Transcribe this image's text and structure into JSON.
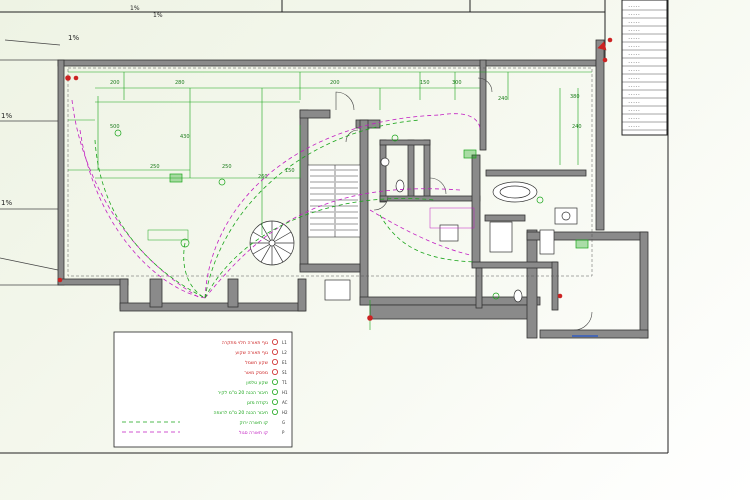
{
  "sheet": {
    "level_marks": [
      "1%",
      "1%",
      "1%"
    ],
    "top_marks": [
      "1%",
      "1%"
    ],
    "dimensions": [
      "200",
      "280",
      "200",
      "250",
      "250",
      "260",
      "240",
      "430",
      "500",
      "380",
      "150",
      "150",
      "300",
      "240"
    ]
  },
  "legend": {
    "rows": [
      {
        "label": "גוף תאורה תלוי מתקרה",
        "code": "L1"
      },
      {
        "label": "גוף תאורה שקוע",
        "code": "L2"
      },
      {
        "label": "שקע חשמל",
        "code": "E1"
      },
      {
        "label": "מפסק מאור",
        "code": "S1"
      },
      {
        "label": "שקע טלפון",
        "code": "T1"
      },
      {
        "label": "חיבור הכנה 20 ס\"מ לקיר",
        "code": "H1"
      },
      {
        "label": "נקודת מזגן",
        "code": "AC"
      },
      {
        "label": "חיבור הכנה 20 ס\"מ לרצפה",
        "code": "H2"
      },
      {
        "label": "קו תאורה ירוק",
        "code": "G"
      },
      {
        "label": "קו תאורה סגול",
        "code": "P"
      }
    ]
  },
  "titleblock": {
    "rows": [
      "-----",
      "-----",
      "-----",
      "-----",
      "-----",
      "-----",
      "-----",
      "-----",
      "-----",
      "-----",
      "-----",
      "-----",
      "-----",
      "-----",
      "-----",
      "-----"
    ]
  },
  "colors": {
    "wall": "#7a7a7a",
    "wall_stroke": "#333333",
    "green": "#1aa51a",
    "magenta": "#c21ec2",
    "red": "#cc2222",
    "purple": "#8a2be2"
  }
}
